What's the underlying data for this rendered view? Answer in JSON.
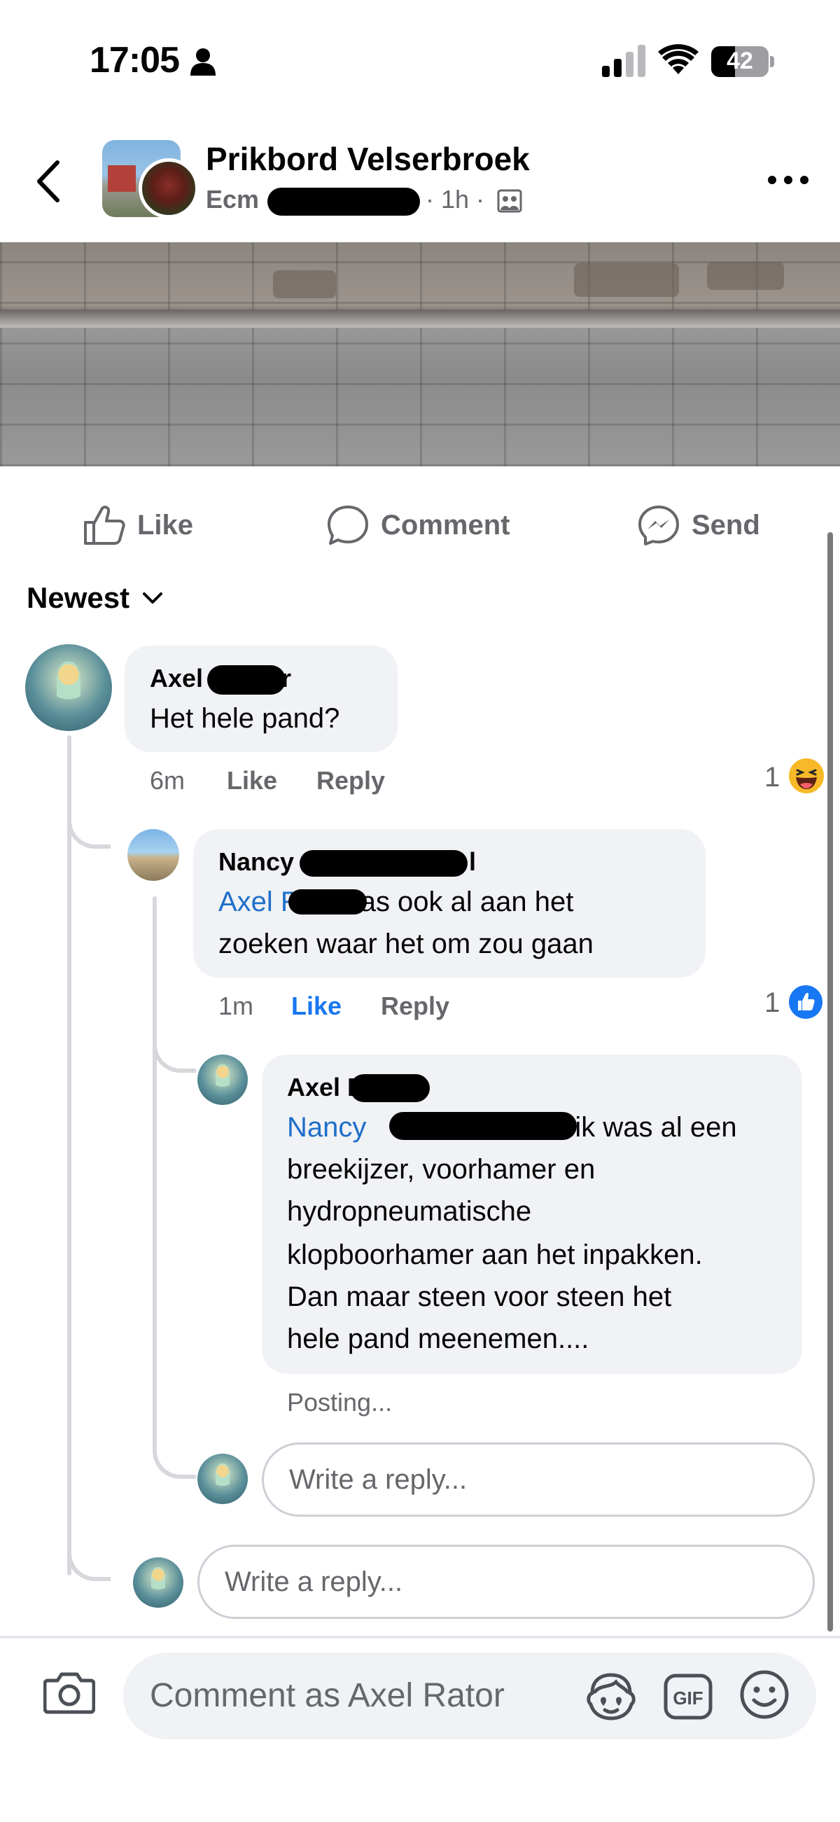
{
  "status_bar": {
    "time": "17:05",
    "battery": "42"
  },
  "header": {
    "group_name": "Prikbord Velserbroek",
    "author_prefix": "Ecm",
    "time": "· 1h ·"
  },
  "actions": {
    "like": "Like",
    "comment": "Comment",
    "send": "Send"
  },
  "sort": {
    "label": "Newest"
  },
  "comments": [
    {
      "author": "Axel",
      "author_suffix": "r",
      "text": "Het hele pand?",
      "time": "6m",
      "like": "Like",
      "reply": "Reply",
      "reaction_count": "1",
      "reaction": "haha"
    },
    {
      "author": "Nancy",
      "author_suffix": "l",
      "mention": "Axel R",
      "text_line1": "ik was ook al aan het",
      "text_line2": "zoeken waar het om zou gaan",
      "time": "1m",
      "like": "Like",
      "reply": "Reply",
      "reaction_count": "1",
      "reaction": "like"
    },
    {
      "author": "Axel R",
      "mention": "Nancy",
      "text_line1": "ik was al een",
      "text_line2": "breekijzer, voorhamer en",
      "text_line3": "hydropneumatische",
      "text_line4": "klopboorhamer aan het inpakken.",
      "text_line5": "Dan maar steen voor steen het",
      "text_line6": "hele pand meenemen....",
      "status": "Posting..."
    }
  ],
  "reply_placeholder_nested": "Write a reply...",
  "reply_placeholder_top": "Write a reply...",
  "composer": {
    "placeholder": "Comment as Axel Rator"
  },
  "colors": {
    "link": "#1f6fc9",
    "like_blue": "#1877f2",
    "bubble": "#f0f2f5",
    "muted": "#65676b"
  }
}
